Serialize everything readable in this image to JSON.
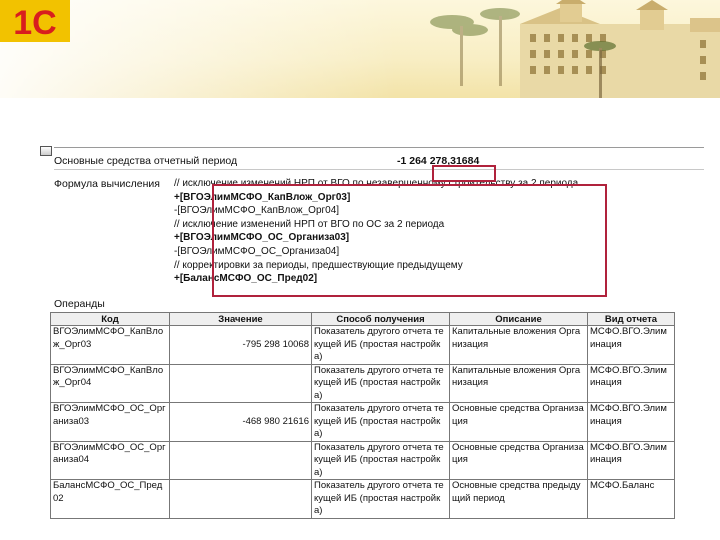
{
  "brand": {
    "logo_text": "1С"
  },
  "report": {
    "title_label": "Основные средства отчетный период",
    "title_value": "-1 264 278,31684",
    "formula_label": "Формула вычисления",
    "formula_lines": [
      "// исключение изменений НРП от ВГО по незавершенному строительству за 2 периода",
      "+[ВГОЭлимМСФО_КапВлож_Орг03]",
      "-[ВГОЭлимМСФО_КапВлож_Орг04]",
      "// исключение изменений НРП от ВГО по ОС за 2 периода",
      "+[ВГОЭлимМСФО_ОС_Организа03]",
      "-[ВГОЭлимМСФО_ОС_Организа04]",
      "// корректировки за периоды, предшествующие предыдущему",
      "+[БалансМСФО_ОС_Пред02]"
    ],
    "operands_label": "Операнды",
    "table": {
      "headers": [
        "Код",
        "Значение",
        "Способ получения",
        "Описание",
        "Вид отчета"
      ],
      "rows": [
        [
          "ВГОЭлимМСФО_КапВлож_Орг03",
          "-795 298 10068",
          "Показатель другого отчета текущей ИБ (простая настройка)",
          "Капитальные вложения Организация",
          "МСФО.ВГО.Элиминация"
        ],
        [
          "ВГОЭлимМСФО_КапВлож_Орг04",
          "",
          "Показатель другого отчета текущей ИБ (простая настройка)",
          "Капитальные вложения Организация",
          "МСФО.ВГО.Элиминация"
        ],
        [
          "ВГОЭлимМСФО_ОС_Организа03",
          "-468 980 21616",
          "Показатель другого отчета текущей ИБ (простая настройка)",
          "Основные средства Организация",
          "МСФО.ВГО.Элиминация"
        ],
        [
          "ВГОЭлимМСФО_ОС_Организа04",
          "",
          "Показатель другого отчета текущей ИБ (простая настройка)",
          "Основные средства Организация",
          "МСФО.ВГО.Элиминация"
        ],
        [
          "БалансМСФО_ОС_Пред02",
          "",
          "Показатель другого отчета текущей ИБ (простая настройка)",
          "Основные средства предыдущий период",
          "МСФО.Баланс"
        ]
      ]
    }
  },
  "colors": {
    "highlight": "#b0223c",
    "logo_red": "#d81e1e",
    "logo_yellow": "#f2c200"
  }
}
